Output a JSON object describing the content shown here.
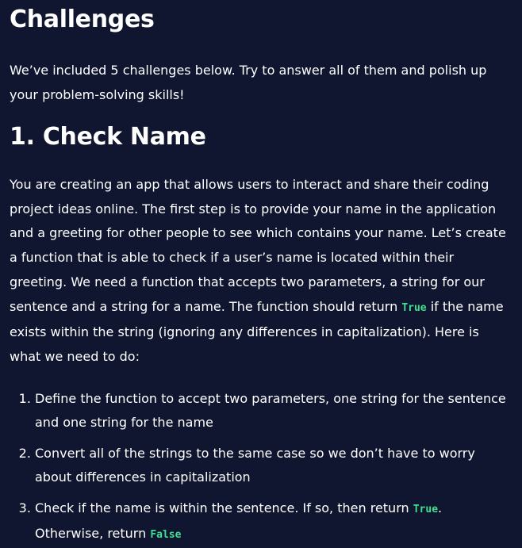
{
  "header": {
    "title": "Challenges"
  },
  "intro": {
    "text": "We’ve included 5 challenges below. Try to answer all of them and polish up your problem-solving skills!"
  },
  "section1": {
    "title": "1. Check Name",
    "paragraph_part1": "You are creating an app that allows users to interact and share their coding project ideas online. The first step is to provide your name in the application and a greeting for other people to see which contains your name. Let’s create a function that is able to check if a user’s name is located within their greeting. We need a function that accepts two parameters, a string for our sentence and a string for a name. The function should return ",
    "paragraph_code": "True",
    "paragraph_part2": " if the name exists within the string (ignoring any differences in capitalization). Here is what we need to do:",
    "steps": [
      {
        "text": "Define the function to accept two parameters, one string for the sentence and one string for the name"
      },
      {
        "text": "Convert all of the strings to the same case so we don’t have to worry about differences in capitalization"
      },
      {
        "text_part1": "Check if the name is within the sentence. If so, then return ",
        "code1": "True",
        "text_part2": ". Otherwise, return ",
        "code2": "False"
      }
    ]
  },
  "colors": {
    "background": "#10162f",
    "text": "#ffffff",
    "code_accent": "#3ee08f"
  }
}
